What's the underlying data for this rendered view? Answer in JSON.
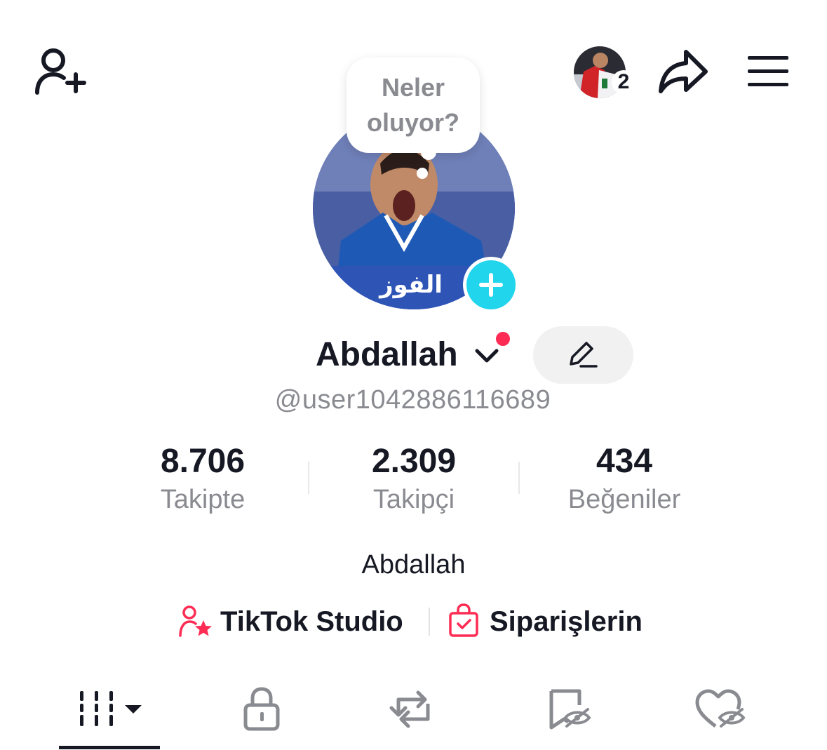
{
  "header": {
    "add_friend_icon": "person-plus-icon",
    "story_count": "2",
    "share_icon": "share-arrow-icon",
    "menu_icon": "hamburger-menu-icon"
  },
  "bubble": {
    "line1": "Neler",
    "line2": "oluyor?"
  },
  "profile": {
    "avatar_caption": "الفوز نقفل",
    "name": "Abdallah",
    "username": "@user1042886116689",
    "bio": "Abdallah",
    "accent_color": "#fe2c55",
    "add_button_color": "#20d5ec"
  },
  "stats": [
    {
      "value": "8.706",
      "label": "Takipte"
    },
    {
      "value": "2.309",
      "label": "Takipçi"
    },
    {
      "value": "434",
      "label": "Beğeniler"
    }
  ],
  "links": {
    "studio": "TikTok Studio",
    "orders": "Siparişlerin"
  },
  "tabs": [
    {
      "name": "videos",
      "icon": "video-grid-icon",
      "active": true
    },
    {
      "name": "private",
      "icon": "lock-icon",
      "active": false
    },
    {
      "name": "reposts",
      "icon": "repost-icon",
      "active": false
    },
    {
      "name": "favorites",
      "icon": "bookmark-hidden-icon",
      "active": false
    },
    {
      "name": "liked",
      "icon": "heart-hidden-icon",
      "active": false
    }
  ]
}
